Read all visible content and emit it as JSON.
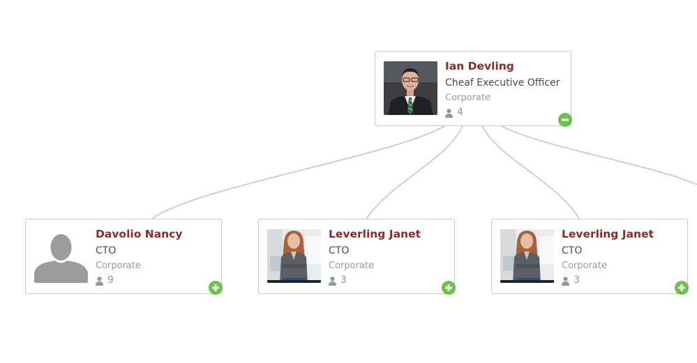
{
  "org_chart": {
    "root": {
      "name": "Ian Devling",
      "title": "Cheaf Executive Officer",
      "department": "Corporate",
      "reports": "4",
      "photo": "man-in-suit-photo",
      "toggle": "collapse"
    },
    "children": [
      {
        "name": "Davolio Nancy",
        "title": "CTO",
        "department": "Corporate",
        "reports": "9",
        "photo": "placeholder-avatar",
        "toggle": "expand"
      },
      {
        "name": "Leverling Janet",
        "title": "CTO",
        "department": "Corporate",
        "reports": "3",
        "photo": "woman-photo",
        "toggle": "expand"
      },
      {
        "name": "Leverling Janet",
        "title": "CTO",
        "department": "Corporate",
        "reports": "3",
        "photo": "woman-photo",
        "toggle": "expand"
      }
    ]
  },
  "colors": {
    "name": "#8b2b2b",
    "title": "#4a4a4a",
    "department": "#9a9a9a",
    "count": "#8a9aa3",
    "border": "#c9c9c9",
    "connector": "#cfcfcf",
    "toggle": "#6cc24a"
  },
  "icons": {
    "reports": "person-icon",
    "expand": "plus-circle-icon",
    "collapse": "minus-circle-icon"
  }
}
